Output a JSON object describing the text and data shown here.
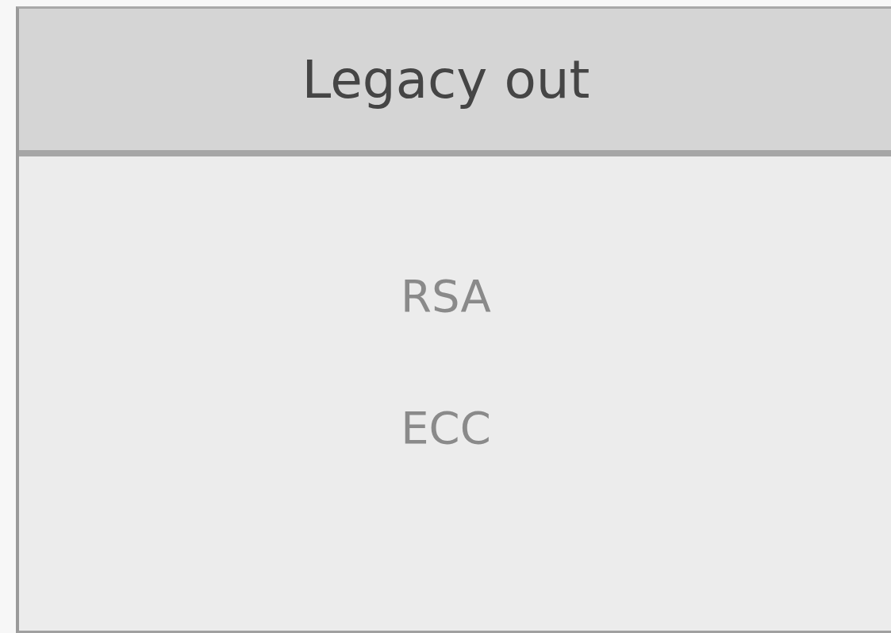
{
  "panel": {
    "title": "Legacy out",
    "items": [
      {
        "label": "RSA"
      },
      {
        "label": "ECC"
      }
    ]
  }
}
